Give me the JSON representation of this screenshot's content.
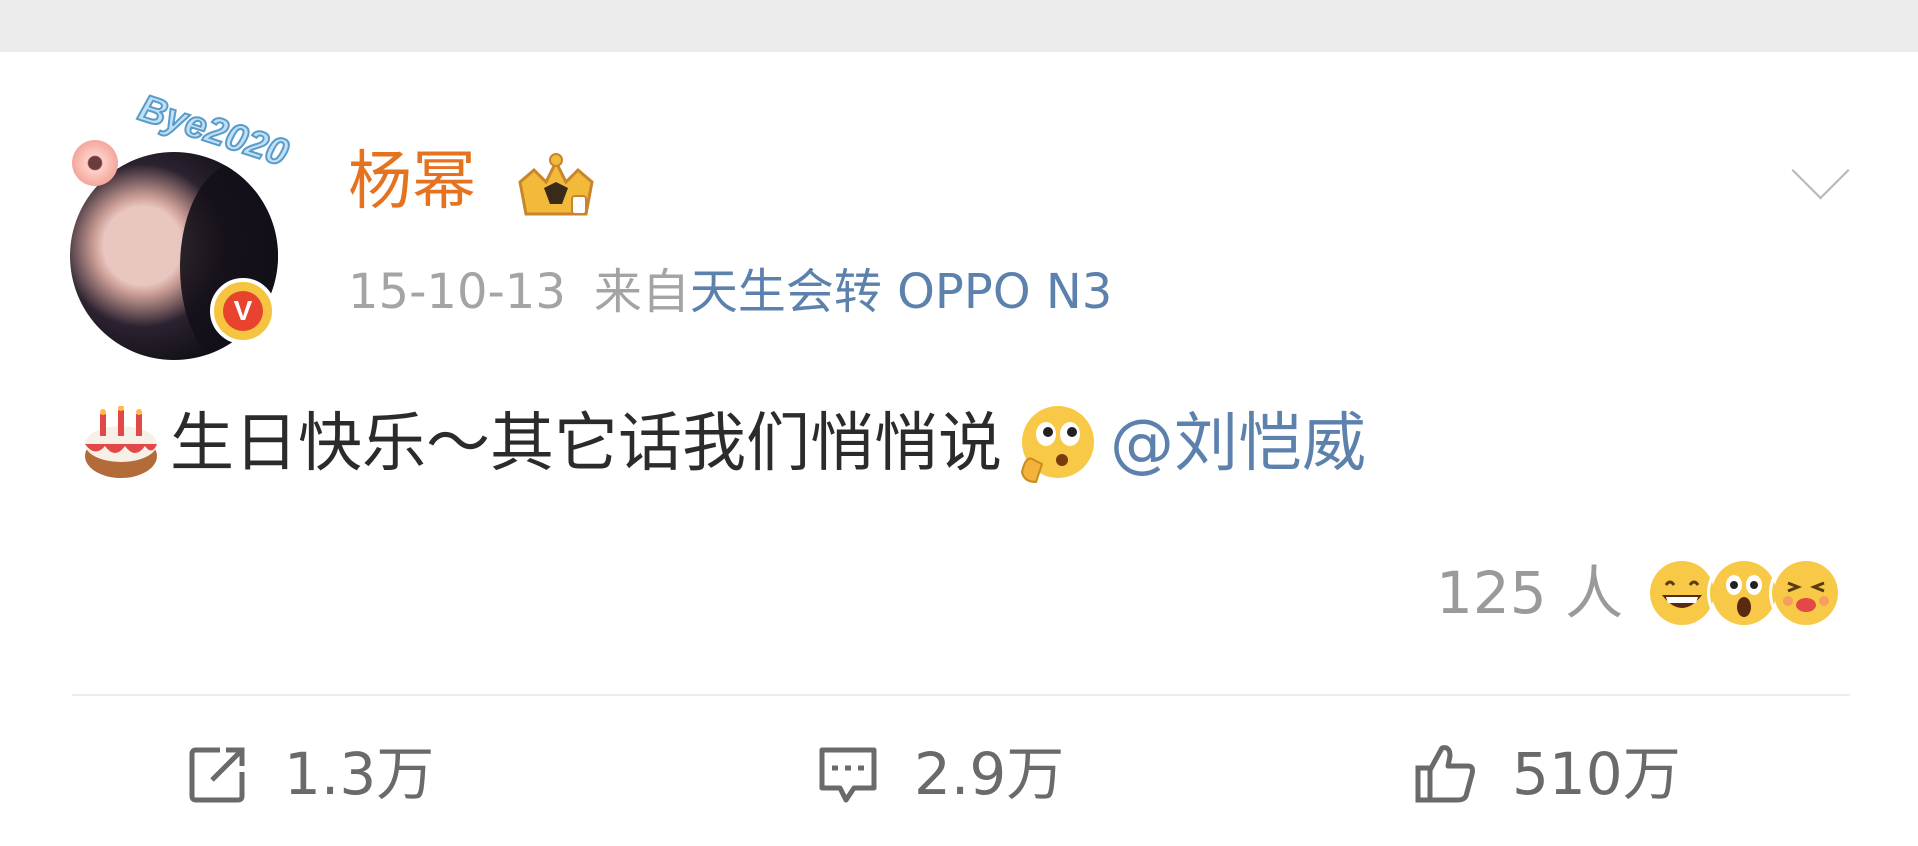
{
  "post": {
    "author": {
      "name": "杨幂",
      "avatar_frame_text": "Bye2020",
      "verified_badge": "V"
    },
    "date": "15-10-13",
    "source_prefix": "来自",
    "source_device": "天生会转 OPPO N3",
    "content": {
      "text": "生日快乐～其它话我们悄悄说",
      "mention": "@刘恺威"
    },
    "reactions": {
      "count_label": "125 人"
    },
    "actions": {
      "repost": "1.3万",
      "comment": "2.9万",
      "like": "510万"
    }
  },
  "icons": [
    "crown-icon",
    "chevron-down-icon",
    "cake-emoji",
    "thinking-emoji",
    "grin-emoji",
    "surprised-emoji",
    "kiss-emoji",
    "repost-icon",
    "comment-icon",
    "like-icon"
  ],
  "colors": {
    "username": "#e5721e",
    "link": "#5d81ad",
    "muted": "#a4a4a4",
    "text": "#2b2b2b",
    "verified": "#e8432e"
  }
}
